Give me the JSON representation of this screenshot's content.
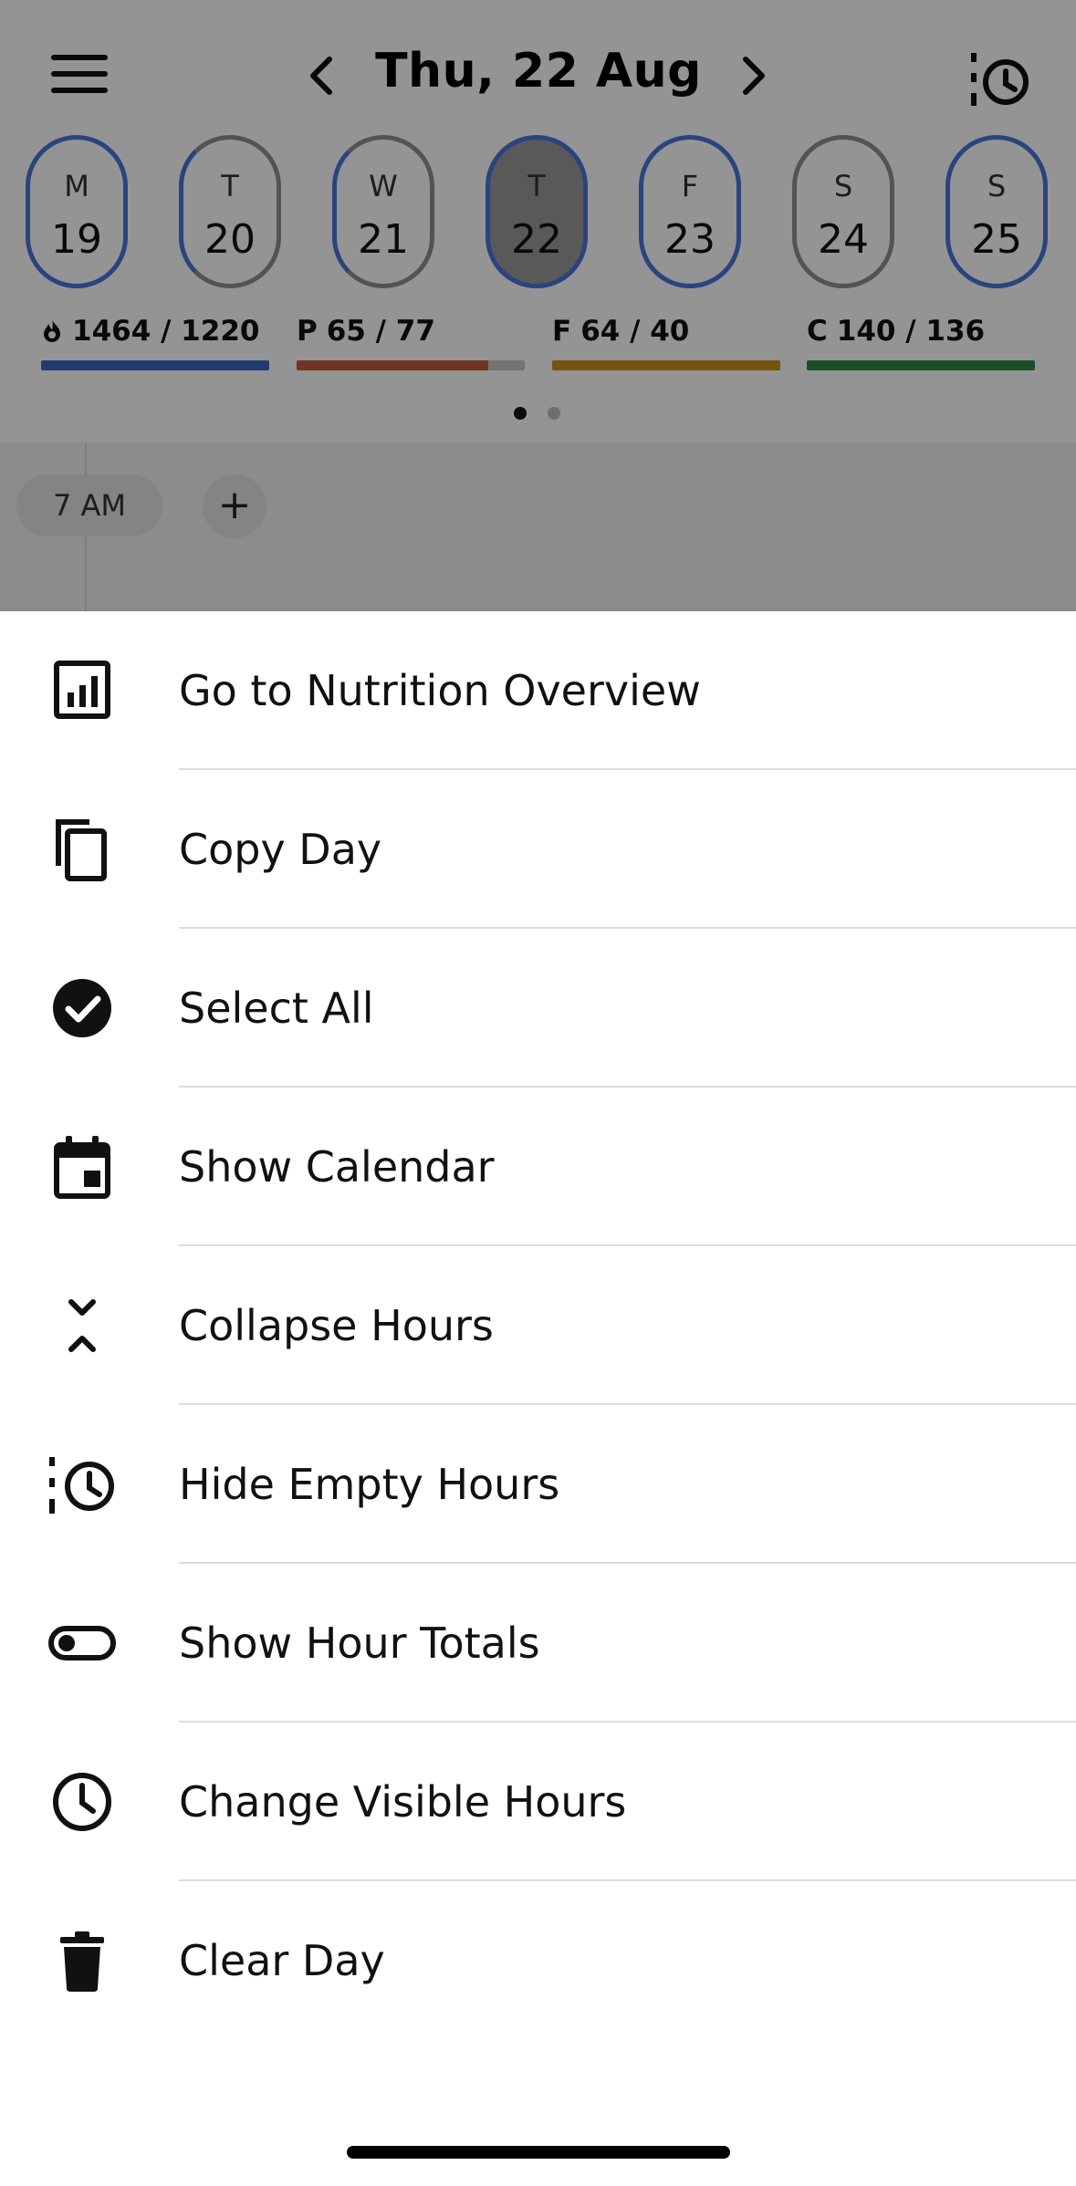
{
  "header": {
    "date_title": "Thu, 22 Aug"
  },
  "week": [
    {
      "letter": "M",
      "number": "19"
    },
    {
      "letter": "T",
      "number": "20"
    },
    {
      "letter": "W",
      "number": "21"
    },
    {
      "letter": "T",
      "number": "22"
    },
    {
      "letter": "F",
      "number": "23"
    },
    {
      "letter": "S",
      "number": "24"
    },
    {
      "letter": "S",
      "number": "25"
    }
  ],
  "macros": {
    "calories": {
      "icon": "flame-icon",
      "value": "1464 / 1220",
      "progress": 1.0,
      "color": "#3b66c7"
    },
    "protein": {
      "letter": "P",
      "value": "65 / 77",
      "progress": 0.84,
      "color": "#c95b3b"
    },
    "fat": {
      "letter": "F",
      "value": "64 / 40",
      "progress": 1.0,
      "color": "#c9921b"
    },
    "carbs": {
      "letter": "C",
      "value": "140 / 136",
      "progress": 1.0,
      "color": "#2e8a46"
    }
  },
  "timeline": {
    "hour_label": "7 AM",
    "add_label": "+"
  },
  "menu": {
    "items": [
      {
        "label": "Go to Nutrition Overview",
        "icon": "chart-icon"
      },
      {
        "label": "Copy Day",
        "icon": "copy-icon"
      },
      {
        "label": "Select All",
        "icon": "check-circle-icon"
      },
      {
        "label": "Show Calendar",
        "icon": "calendar-icon"
      },
      {
        "label": "Collapse Hours",
        "icon": "collapse-icon"
      },
      {
        "label": "Hide Empty Hours",
        "icon": "history-icon"
      },
      {
        "label": "Show Hour Totals",
        "icon": "toggle-off-icon"
      },
      {
        "label": "Change Visible Hours",
        "icon": "clock-icon"
      },
      {
        "label": "Clear Day",
        "icon": "trash-icon"
      }
    ]
  }
}
